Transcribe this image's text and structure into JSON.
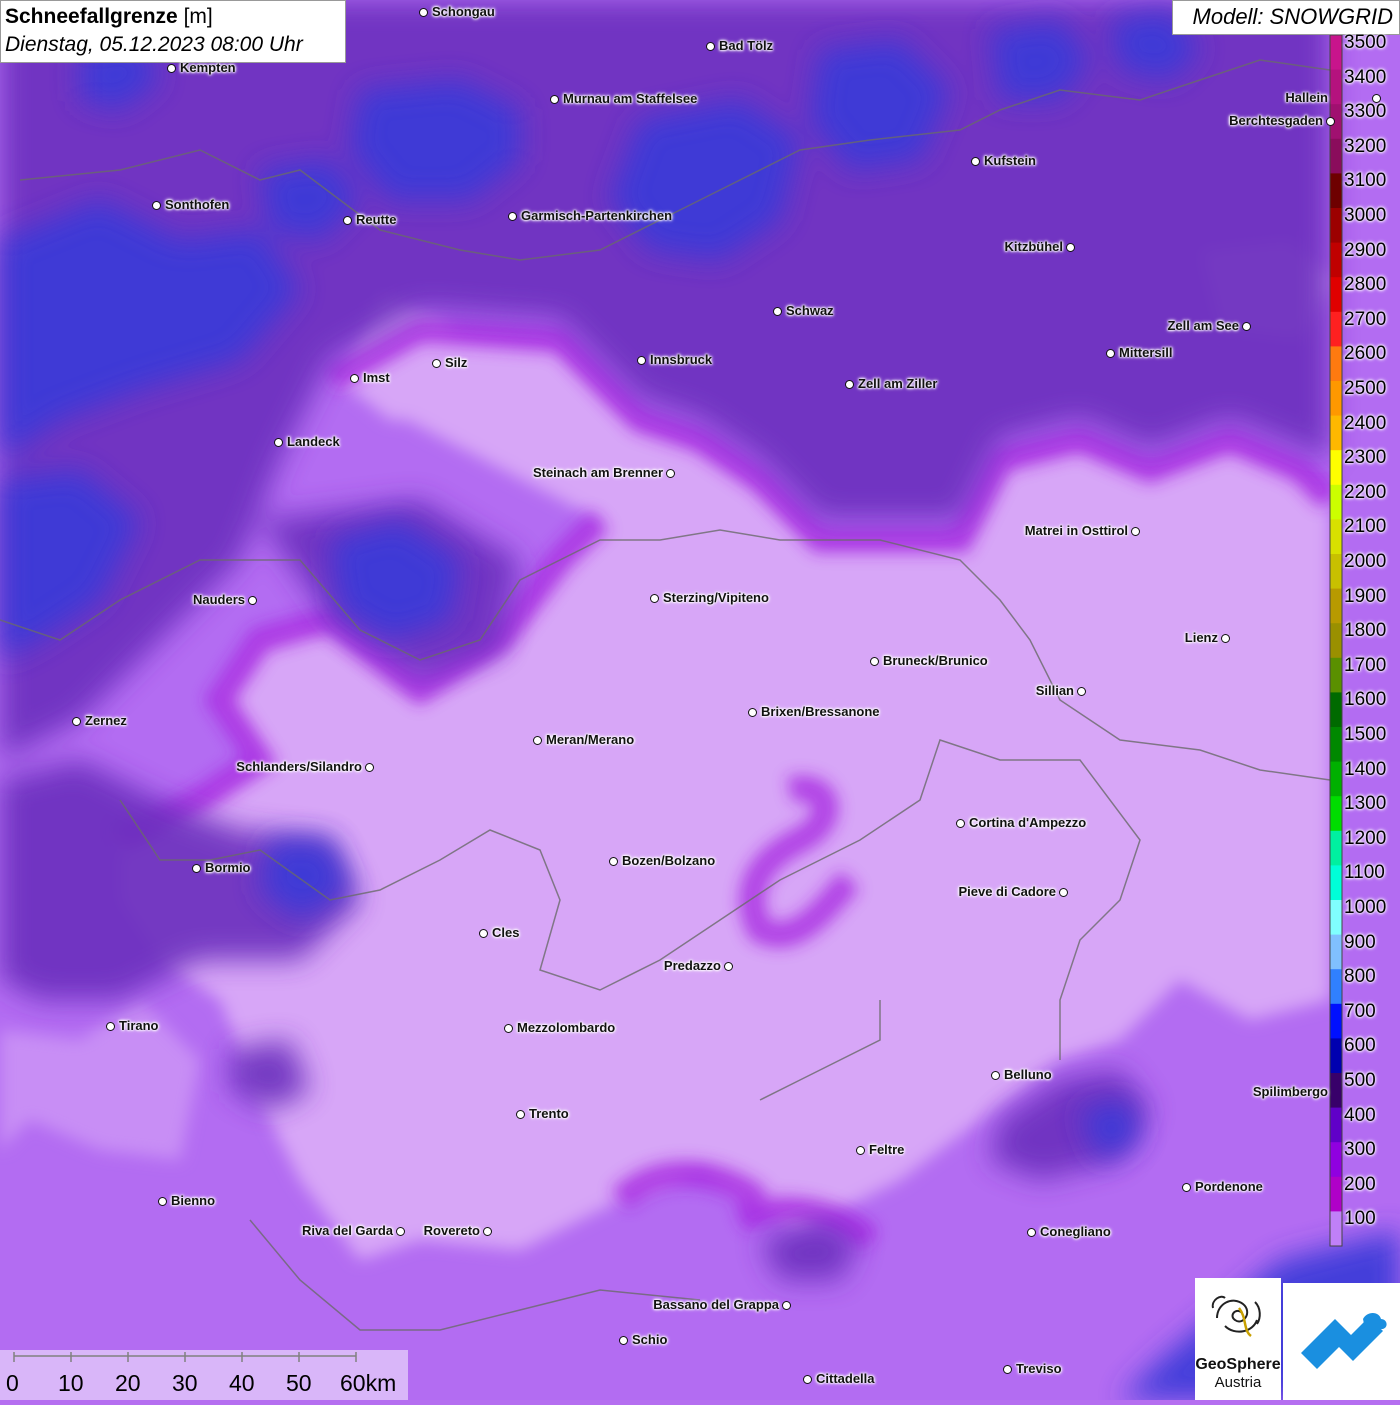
{
  "title": {
    "name": "Schneefallgrenze",
    "unit": "[m]",
    "datetime": "Dienstag, 05.12.2023 08:00 Uhr"
  },
  "model": "Modell: SNOWGRID",
  "legend": [
    {
      "label": "3500",
      "color": "#c8148c"
    },
    {
      "label": "3400",
      "color": "#b5127e"
    },
    {
      "label": "3300",
      "color": "#a01070"
    },
    {
      "label": "3200",
      "color": "#8a0c5c"
    },
    {
      "label": "3100",
      "color": "#6e0000"
    },
    {
      "label": "3000",
      "color": "#9c0000"
    },
    {
      "label": "2900",
      "color": "#c00000"
    },
    {
      "label": "2800",
      "color": "#e00000"
    },
    {
      "label": "2700",
      "color": "#ff2020"
    },
    {
      "label": "2600",
      "color": "#ff7a10"
    },
    {
      "label": "2500",
      "color": "#ff9800"
    },
    {
      "label": "2400",
      "color": "#ffb800"
    },
    {
      "label": "2300",
      "color": "#ffff00"
    },
    {
      "label": "2200",
      "color": "#ccff00"
    },
    {
      "label": "2100",
      "color": "#d8e000"
    },
    {
      "label": "2000",
      "color": "#c8c000"
    },
    {
      "label": "1900",
      "color": "#b89a00"
    },
    {
      "label": "1800",
      "color": "#9a9000"
    },
    {
      "label": "1700",
      "color": "#5a9000"
    },
    {
      "label": "1600",
      "color": "#006a00"
    },
    {
      "label": "1500",
      "color": "#008800"
    },
    {
      "label": "1400",
      "color": "#00b000"
    },
    {
      "label": "1300",
      "color": "#00dd00"
    },
    {
      "label": "1200",
      "color": "#00f0a0"
    },
    {
      "label": "1100",
      "color": "#00ffd8"
    },
    {
      "label": "1000",
      "color": "#80ffff"
    },
    {
      "label": "900",
      "color": "#80c0ff"
    },
    {
      "label": "800",
      "color": "#3080ff"
    },
    {
      "label": "700",
      "color": "#0010ff"
    },
    {
      "label": "600",
      "color": "#0000b0"
    },
    {
      "label": "500",
      "color": "#38006a"
    },
    {
      "label": "400",
      "color": "#6000c8"
    },
    {
      "label": "300",
      "color": "#9000e0"
    },
    {
      "label": "200",
      "color": "#b000c8"
    },
    {
      "label": "100",
      "color": "#c080f8"
    }
  ],
  "cities": [
    {
      "name": "Schongau"
    },
    {
      "name": "Kempten"
    },
    {
      "name": "Bad Tölz"
    },
    {
      "name": "Murnau am Staffelsee"
    },
    {
      "name": "Kufstein"
    },
    {
      "name": "Berchtesgaden"
    },
    {
      "name": "Sonthofen"
    },
    {
      "name": "Reutte"
    },
    {
      "name": "Garmisch-Partenkirchen"
    },
    {
      "name": "Kitzbühel"
    },
    {
      "name": "Schwaz"
    },
    {
      "name": "Zell am See"
    },
    {
      "name": "Innsbruck"
    },
    {
      "name": "Mittersill"
    },
    {
      "name": "Imst"
    },
    {
      "name": "Silz"
    },
    {
      "name": "Zell am Ziller"
    },
    {
      "name": "Landeck"
    },
    {
      "name": "Steinach am Brenner"
    },
    {
      "name": "Matrei in Osttirol"
    },
    {
      "name": "Nauders"
    },
    {
      "name": "Sterzing/Vipiteno"
    },
    {
      "name": "Lienz"
    },
    {
      "name": "Bruneck/Brunico"
    },
    {
      "name": "Sillian"
    },
    {
      "name": "Zernez"
    },
    {
      "name": "Brixen/Bressanone"
    },
    {
      "name": "Meran/Merano"
    },
    {
      "name": "Schlanders/Silandro"
    },
    {
      "name": "Cortina d'Ampezzo"
    },
    {
      "name": "Bormio"
    },
    {
      "name": "Bozen/Bolzano"
    },
    {
      "name": "Pieve di Cadore"
    },
    {
      "name": "Cles"
    },
    {
      "name": "Predazzo"
    },
    {
      "name": "Tirano"
    },
    {
      "name": "Mezzolombardo"
    },
    {
      "name": "Belluno"
    },
    {
      "name": "Trento"
    },
    {
      "name": "Feltre"
    },
    {
      "name": "Pordenone"
    },
    {
      "name": "Bienno"
    },
    {
      "name": "Riva del Garda"
    },
    {
      "name": "Rovereto"
    },
    {
      "name": "Conegliano"
    },
    {
      "name": "Bassano del Grappa"
    },
    {
      "name": "Schio"
    },
    {
      "name": "Treviso"
    },
    {
      "name": "Cittadella"
    },
    {
      "name": "Spilimbergo"
    },
    {
      "name": "Hallein"
    }
  ],
  "scale": {
    "ticks": [
      "0",
      "10",
      "20",
      "30",
      "40",
      "50",
      "60km"
    ]
  },
  "logo": {
    "name": "GeoSphere",
    "sub": "Austria"
  }
}
